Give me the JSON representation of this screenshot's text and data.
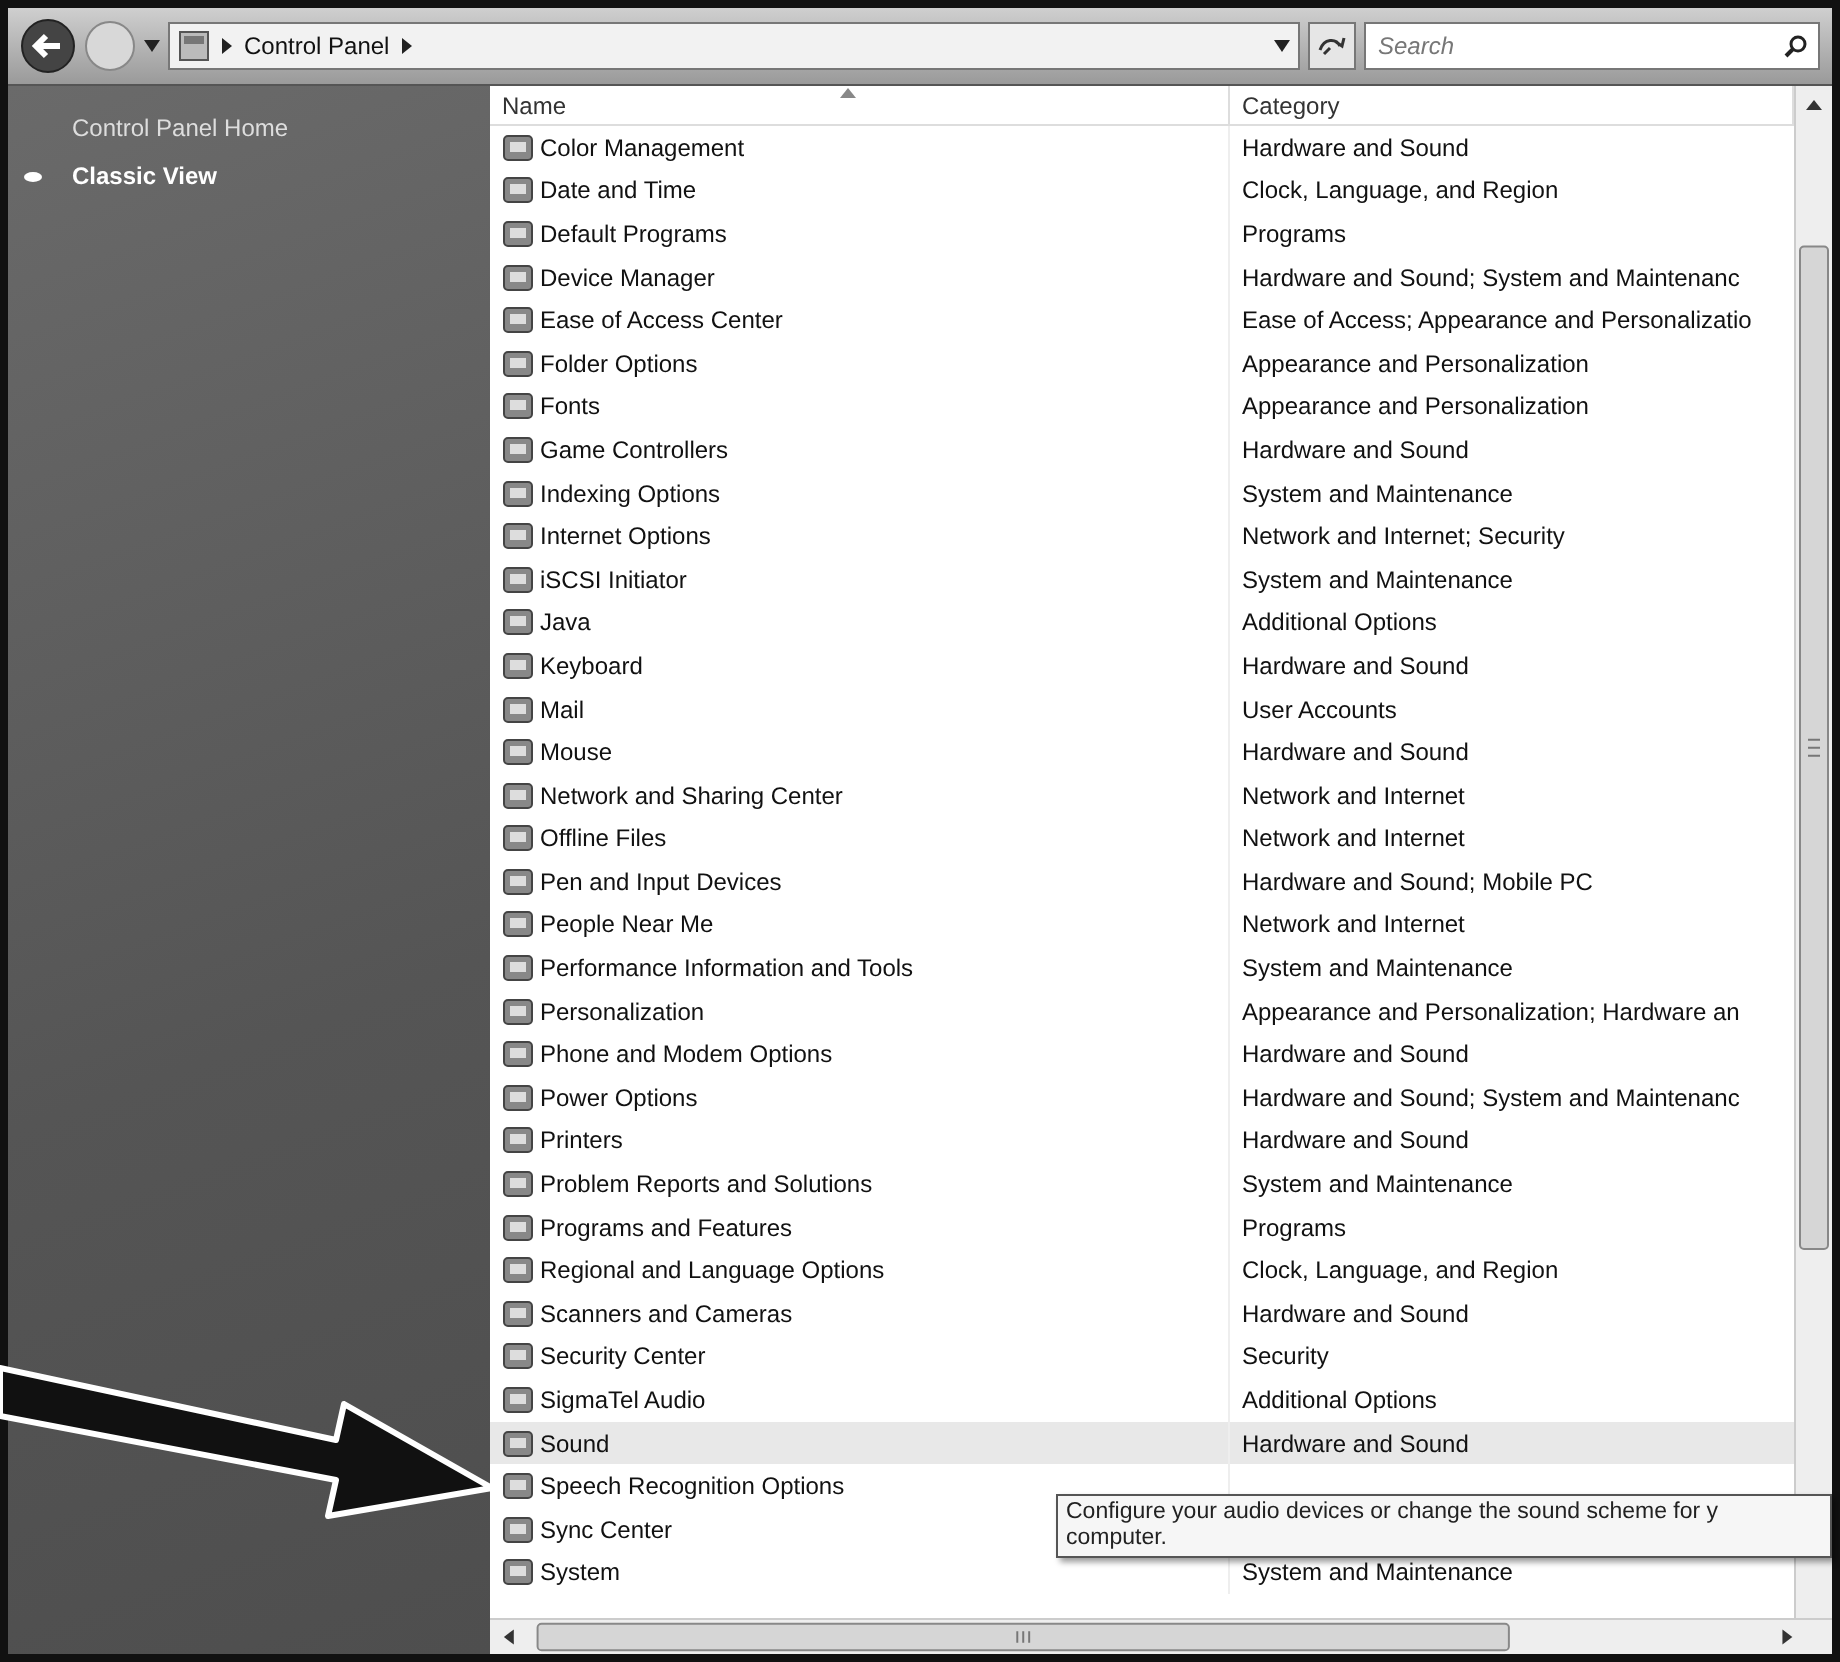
{
  "address_bar": {
    "breadcrumb": "Control Panel",
    "search": {
      "placeholder": "Search"
    }
  },
  "sidebar": {
    "items": [
      {
        "label": "Control Panel Home",
        "selected": false
      },
      {
        "label": "Classic View",
        "selected": true
      }
    ]
  },
  "list": {
    "columns": [
      "Name",
      "Category"
    ],
    "rows": [
      {
        "name": "Color Management",
        "category": "Hardware and Sound",
        "selected": false
      },
      {
        "name": "Date and Time",
        "category": "Clock, Language, and Region",
        "selected": false
      },
      {
        "name": "Default Programs",
        "category": "Programs",
        "selected": false
      },
      {
        "name": "Device Manager",
        "category": "Hardware and Sound; System and Maintenanc",
        "selected": false
      },
      {
        "name": "Ease of Access Center",
        "category": "Ease of Access; Appearance and Personalizatio",
        "selected": false
      },
      {
        "name": "Folder Options",
        "category": "Appearance and Personalization",
        "selected": false
      },
      {
        "name": "Fonts",
        "category": "Appearance and Personalization",
        "selected": false
      },
      {
        "name": "Game Controllers",
        "category": "Hardware and Sound",
        "selected": false
      },
      {
        "name": "Indexing Options",
        "category": "System and Maintenance",
        "selected": false
      },
      {
        "name": "Internet Options",
        "category": "Network and Internet; Security",
        "selected": false
      },
      {
        "name": "iSCSI Initiator",
        "category": "System and Maintenance",
        "selected": false
      },
      {
        "name": "Java",
        "category": "Additional Options",
        "selected": false
      },
      {
        "name": "Keyboard",
        "category": "Hardware and Sound",
        "selected": false
      },
      {
        "name": "Mail",
        "category": "User Accounts",
        "selected": false
      },
      {
        "name": "Mouse",
        "category": "Hardware and Sound",
        "selected": false
      },
      {
        "name": "Network and Sharing Center",
        "category": "Network and Internet",
        "selected": false
      },
      {
        "name": "Offline Files",
        "category": "Network and Internet",
        "selected": false
      },
      {
        "name": "Pen and Input Devices",
        "category": "Hardware and Sound; Mobile PC",
        "selected": false
      },
      {
        "name": "People Near Me",
        "category": "Network and Internet",
        "selected": false
      },
      {
        "name": "Performance Information and Tools",
        "category": "System and Maintenance",
        "selected": false
      },
      {
        "name": "Personalization",
        "category": "Appearance and Personalization; Hardware an",
        "selected": false
      },
      {
        "name": "Phone and Modem Options",
        "category": "Hardware and Sound",
        "selected": false
      },
      {
        "name": "Power Options",
        "category": "Hardware and Sound; System and Maintenanc",
        "selected": false
      },
      {
        "name": "Printers",
        "category": "Hardware and Sound",
        "selected": false
      },
      {
        "name": "Problem Reports and Solutions",
        "category": "System and Maintenance",
        "selected": false
      },
      {
        "name": "Programs and Features",
        "category": "Programs",
        "selected": false
      },
      {
        "name": "Regional and Language Options",
        "category": "Clock, Language, and Region",
        "selected": false
      },
      {
        "name": "Scanners and Cameras",
        "category": "Hardware and Sound",
        "selected": false
      },
      {
        "name": "Security Center",
        "category": "Security",
        "selected": false
      },
      {
        "name": "SigmaTel Audio",
        "category": "Additional Options",
        "selected": false
      },
      {
        "name": "Sound",
        "category": "Hardware and Sound",
        "selected": true
      },
      {
        "name": "Speech Recognition Options",
        "selected": false
      },
      {
        "name": "Sync Center",
        "selected": false
      },
      {
        "name": "System",
        "category": "System and Maintenance",
        "selected": false
      }
    ]
  },
  "tooltip": {
    "lines": [
      "Configure your audio devices or change the sound scheme for y",
      "computer."
    ]
  }
}
